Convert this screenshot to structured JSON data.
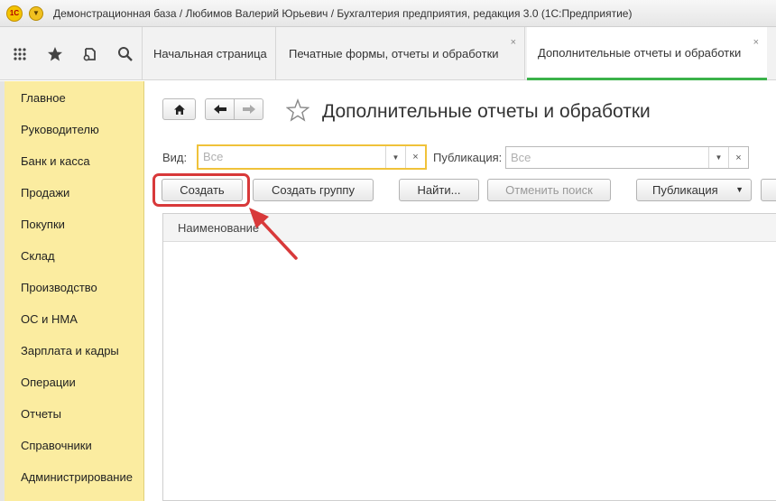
{
  "window": {
    "title": "Демонстрационная база / Любимов Валерий Юрьевич / Бухгалтерия предприятия, редакция 3.0  (1С:Предприятие)",
    "logo_text": "1С"
  },
  "toolbar": {
    "icons": [
      "apps-grid-icon",
      "star-icon",
      "history-icon",
      "search-icon"
    ]
  },
  "tabs": [
    {
      "label": "Начальная страница",
      "active": false,
      "closable": false
    },
    {
      "label": "Печатные формы, отчеты и обработки",
      "active": false,
      "closable": true
    },
    {
      "label": "Дополнительные отчеты и обработки",
      "active": true,
      "closable": true
    }
  ],
  "close_glyph": "×",
  "sidebar": {
    "items": [
      {
        "label": "Главное"
      },
      {
        "label": "Руководителю"
      },
      {
        "label": "Банк и касса"
      },
      {
        "label": "Продажи"
      },
      {
        "label": "Покупки"
      },
      {
        "label": "Склад"
      },
      {
        "label": "Производство"
      },
      {
        "label": "ОС и НМА"
      },
      {
        "label": "Зарплата и кадры"
      },
      {
        "label": "Операции"
      },
      {
        "label": "Отчеты"
      },
      {
        "label": "Справочники"
      },
      {
        "label": "Администрирование"
      }
    ]
  },
  "page": {
    "title": "Дополнительные отчеты и обработки"
  },
  "filters": {
    "vid_label": "Вид:",
    "vid_placeholder": "Все",
    "pub_label": "Публикация:",
    "pub_placeholder": "Все"
  },
  "buttons": {
    "create": "Создать",
    "create_group": "Создать группу",
    "find": "Найти...",
    "cancel_search": "Отменить поиск",
    "publication": "Публикация"
  },
  "table": {
    "columns": [
      "Наименование"
    ]
  },
  "colors": {
    "accent_green": "#3bb24a",
    "sidebar_bg": "#fbeca0",
    "highlight_red": "#d8393a",
    "field_focus": "#f0c23a"
  }
}
